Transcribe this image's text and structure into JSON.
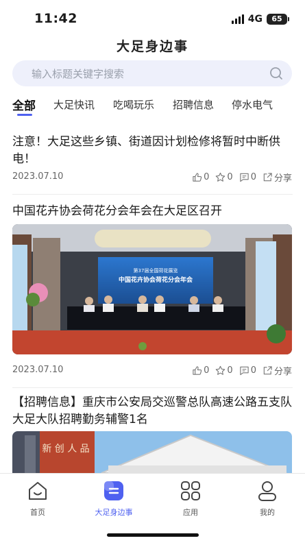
{
  "status_bar": {
    "time": "11:42",
    "network": "4G",
    "battery": "65"
  },
  "header": {
    "title": "大足身边事"
  },
  "search": {
    "placeholder": "输入标题关键字搜索"
  },
  "tabs": [
    {
      "label": "全部",
      "active": true
    },
    {
      "label": "大足快讯"
    },
    {
      "label": "吃喝玩乐"
    },
    {
      "label": "招聘信息"
    },
    {
      "label": "停水电气"
    }
  ],
  "articles": [
    {
      "title": "注意！大足这些乡镇、街道因计划检修将暂时中断供电！",
      "date": "2023.07.10",
      "likes": "0",
      "favorites": "0",
      "comments": "0",
      "share_label": "分享"
    },
    {
      "title": "中国花卉协会荷花分会年会在大足区召开",
      "date": "2023.07.10",
      "likes": "0",
      "favorites": "0",
      "comments": "0",
      "share_label": "分享",
      "image": {
        "banner_line1": "第37届全国荷花展览",
        "banner_line2": "中国花卉协会荷花分会年会"
      }
    },
    {
      "title": "【招聘信息】重庆市公安局交巡警总队高速公路五支队大足大队招聘勤务辅警1名",
      "image": {
        "sign_text": "新 创 人 品"
      }
    }
  ],
  "bottom_nav": [
    {
      "label": "首页",
      "icon": "home-icon"
    },
    {
      "label": "大足身边事",
      "icon": "local-news-icon",
      "active": true
    },
    {
      "label": "应用",
      "icon": "apps-grid-icon"
    },
    {
      "label": "我的",
      "icon": "profile-icon"
    }
  ],
  "colors": {
    "accent": "#4f61f0",
    "search_bg": "#eef0fb",
    "text": "#1b1b1b",
    "muted": "#666666"
  }
}
